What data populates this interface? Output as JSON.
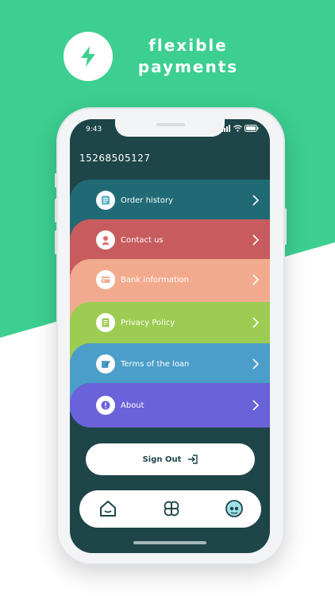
{
  "hero": {
    "title_line1": "flexible",
    "title_line2": "payments",
    "icon": "lightning-bolt-icon"
  },
  "status_bar": {
    "time": "9:43",
    "icons": [
      "signal-icon",
      "wifi-icon",
      "battery-icon"
    ]
  },
  "account": {
    "phone": "15268505127"
  },
  "menu": [
    {
      "label": "Order history",
      "icon": "order-history-icon",
      "color": "#1f6a75"
    },
    {
      "label": "Contact us",
      "icon": "contact-icon",
      "color": "#c75b5e"
    },
    {
      "label": "Bank information",
      "icon": "bank-card-icon",
      "color": "#f2aa8e"
    },
    {
      "label": "Privacy Policy",
      "icon": "privacy-document-icon",
      "color": "#9ccc52"
    },
    {
      "label": "Terms of the loan",
      "icon": "terms-edit-icon",
      "color": "#4b9ec9"
    },
    {
      "label": "About",
      "icon": "about-info-icon",
      "color": "#6a62d9"
    }
  ],
  "sign_out": {
    "label": "Sign Out",
    "icon": "logout-arrow-icon"
  },
  "tab_bar": [
    {
      "name": "home",
      "icon": "home-icon"
    },
    {
      "name": "services",
      "icon": "clover-grid-icon"
    },
    {
      "name": "profile",
      "icon": "profile-avatar-icon"
    }
  ],
  "colors": {
    "background_accent": "#3ccf91",
    "screen_background": "#1e4548",
    "text_light": "#ffffff"
  }
}
